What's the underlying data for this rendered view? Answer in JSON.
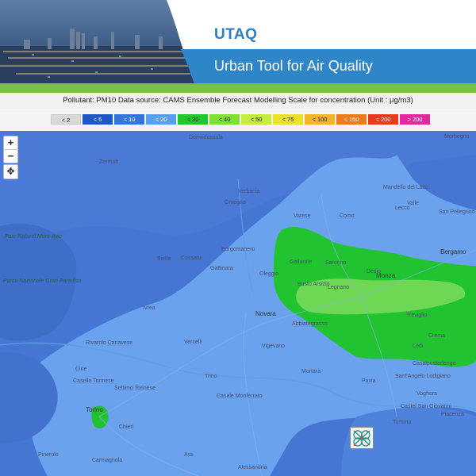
{
  "header": {
    "abbrev": "UTAQ",
    "title": "Urban Tool for Air Quality"
  },
  "info": {
    "text": "Pollutant: PM10 Data source: CAMS Ensemble Forecast Modelling Scale for concentration (Unit : μg/m3)"
  },
  "legend": [
    {
      "label": "< 2",
      "color": "#d9d9d9"
    },
    {
      "label": "< 5",
      "color": "#1f57c7"
    },
    {
      "label": "< 10",
      "color": "#3474dd"
    },
    {
      "label": "< 20",
      "color": "#58a0ee"
    },
    {
      "label": "< 30",
      "color": "#1fc82a"
    },
    {
      "label": "< 40",
      "color": "#7ee030"
    },
    {
      "label": "< 50",
      "color": "#c4ec3a"
    },
    {
      "label": "< 75",
      "color": "#ece22a"
    },
    {
      "label": "< 100",
      "color": "#f5b426"
    },
    {
      "label": "< 150",
      "color": "#ee7a1e"
    },
    {
      "label": "< 200",
      "color": "#ea3a1c"
    },
    {
      "label": "> 200",
      "color": "#e22a9c"
    }
  ],
  "controls": {
    "zoom_in": "+",
    "zoom_out": "−",
    "move": "✥"
  },
  "places": [
    {
      "name": "Domodossola",
      "cls": ""
    },
    {
      "name": "Zermatt",
      "cls": ""
    },
    {
      "name": "Verbania",
      "cls": ""
    },
    {
      "name": "Omegna",
      "cls": ""
    },
    {
      "name": "Varese",
      "cls": ""
    },
    {
      "name": "Como",
      "cls": ""
    },
    {
      "name": "Lecco",
      "cls": ""
    },
    {
      "name": "Bergamo",
      "cls": "big"
    },
    {
      "name": "Morbegno",
      "cls": ""
    },
    {
      "name": "Mandello del Lario",
      "cls": ""
    },
    {
      "name": "Valle",
      "cls": ""
    },
    {
      "name": "San Pellegrino Terme",
      "cls": ""
    },
    {
      "name": "Parc Naturel Mont-Avic",
      "cls": "park"
    },
    {
      "name": "Parco Nazionale Gran Paradiso",
      "cls": "park"
    },
    {
      "name": "Biella",
      "cls": ""
    },
    {
      "name": "Cossato",
      "cls": ""
    },
    {
      "name": "Borgomanero",
      "cls": ""
    },
    {
      "name": "Gattinara",
      "cls": ""
    },
    {
      "name": "Oleggio",
      "cls": ""
    },
    {
      "name": "Busto Arsizio",
      "cls": ""
    },
    {
      "name": "Gallarate",
      "cls": ""
    },
    {
      "name": "Saronno",
      "cls": ""
    },
    {
      "name": "Monza",
      "cls": "big"
    },
    {
      "name": "Desio",
      "cls": ""
    },
    {
      "name": "Legnano",
      "cls": ""
    },
    {
      "name": "Treviglio",
      "cls": ""
    },
    {
      "name": "Novara",
      "cls": "big"
    },
    {
      "name": "Abbiategrasso",
      "cls": ""
    },
    {
      "name": "Vigevano",
      "cls": ""
    },
    {
      "name": "Crema",
      "cls": ""
    },
    {
      "name": "Lodi",
      "cls": ""
    },
    {
      "name": "Pavia",
      "cls": ""
    },
    {
      "name": "Vercelli",
      "cls": ""
    },
    {
      "name": "Ivrea",
      "cls": ""
    },
    {
      "name": "Rivarolo Canavese",
      "cls": ""
    },
    {
      "name": "Cirie",
      "cls": ""
    },
    {
      "name": "Caselle Torinese",
      "cls": ""
    },
    {
      "name": "Settimo Torinese",
      "cls": ""
    },
    {
      "name": "Torino",
      "cls": "big"
    },
    {
      "name": "Chieri",
      "cls": ""
    },
    {
      "name": "Pinerolo",
      "cls": ""
    },
    {
      "name": "Carmagnola",
      "cls": ""
    },
    {
      "name": "Trino",
      "cls": ""
    },
    {
      "name": "Casale Monferrato",
      "cls": ""
    },
    {
      "name": "Mortara",
      "cls": ""
    },
    {
      "name": "Voghera",
      "cls": ""
    },
    {
      "name": "Asti",
      "cls": ""
    },
    {
      "name": "Alessandria",
      "cls": ""
    },
    {
      "name": "Piacenza",
      "cls": ""
    },
    {
      "name": "Casalpusterlengo",
      "cls": ""
    },
    {
      "name": "Castel San Giovanni",
      "cls": ""
    },
    {
      "name": "Tortona",
      "cls": ""
    },
    {
      "name": "Sant'Angelo Lodigiano",
      "cls": ""
    }
  ]
}
